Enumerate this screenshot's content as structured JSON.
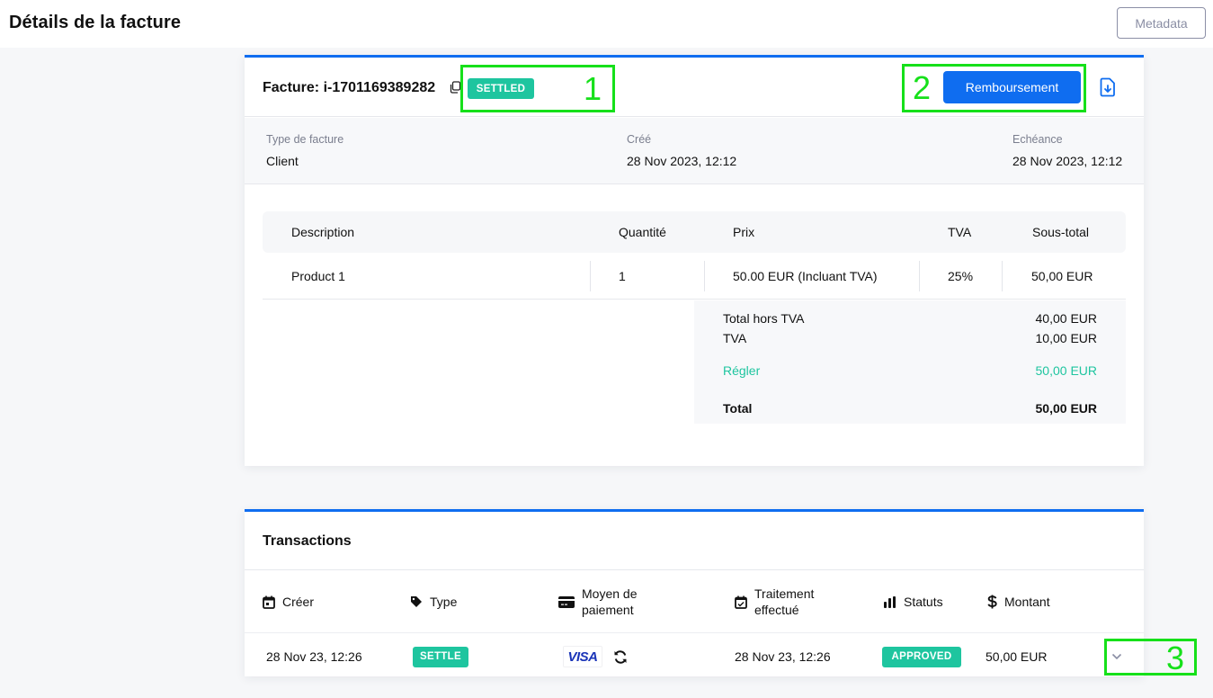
{
  "header": {
    "title": "Détails de la facture",
    "metadata_label": "Metadata"
  },
  "invoice": {
    "title": "Facture: i-1701169389282",
    "status": "SETTLED",
    "refund_label": "Remboursement",
    "meta": {
      "type_label": "Type de facture",
      "type_value": "Client",
      "created_label": "Créé",
      "created_value": "28 Nov 2023, 12:12",
      "due_label": "Echéance",
      "due_value": "28 Nov 2023, 12:12"
    },
    "items": {
      "columns": [
        "Description",
        "Quantité",
        "Prix",
        "TVA",
        "Sous-total"
      ],
      "rows": [
        [
          "Product 1",
          "1",
          "50.00 EUR (Incluant TVA)",
          "25%",
          "50,00 EUR"
        ]
      ]
    },
    "totals": {
      "subtotal_label": "Total hors TVA",
      "subtotal_value": "40,00 EUR",
      "vat_label": "TVA",
      "vat_value": "10,00 EUR",
      "settled_label": "Régler",
      "settled_value": "50,00 EUR",
      "total_label": "Total",
      "total_value": "50,00 EUR"
    }
  },
  "transactions": {
    "title": "Transactions",
    "columns": [
      {
        "label": "Créer",
        "icon": "calendar-icon"
      },
      {
        "label": "Type",
        "icon": "tag-icon"
      },
      {
        "label": "Moyen de paiement",
        "icon": "credit-card-icon"
      },
      {
        "label": "Traitement effectué",
        "icon": "calendar-check-icon"
      },
      {
        "label": "Statuts",
        "icon": "bar-chart-icon"
      },
      {
        "label": "Montant",
        "icon": "dollar-icon"
      }
    ],
    "rows": [
      {
        "created": "28 Nov 23, 12:26",
        "type": "SETTLE",
        "payment_method": "VISA",
        "processed": "28 Nov 23, 12:26",
        "status": "APPROVED",
        "amount": "50,00 EUR"
      }
    ]
  },
  "annotations": [
    "1",
    "2",
    "3"
  ],
  "colors": {
    "accent": "#0f6df0",
    "success": "#1ec59f",
    "annotation": "#16e01a"
  }
}
